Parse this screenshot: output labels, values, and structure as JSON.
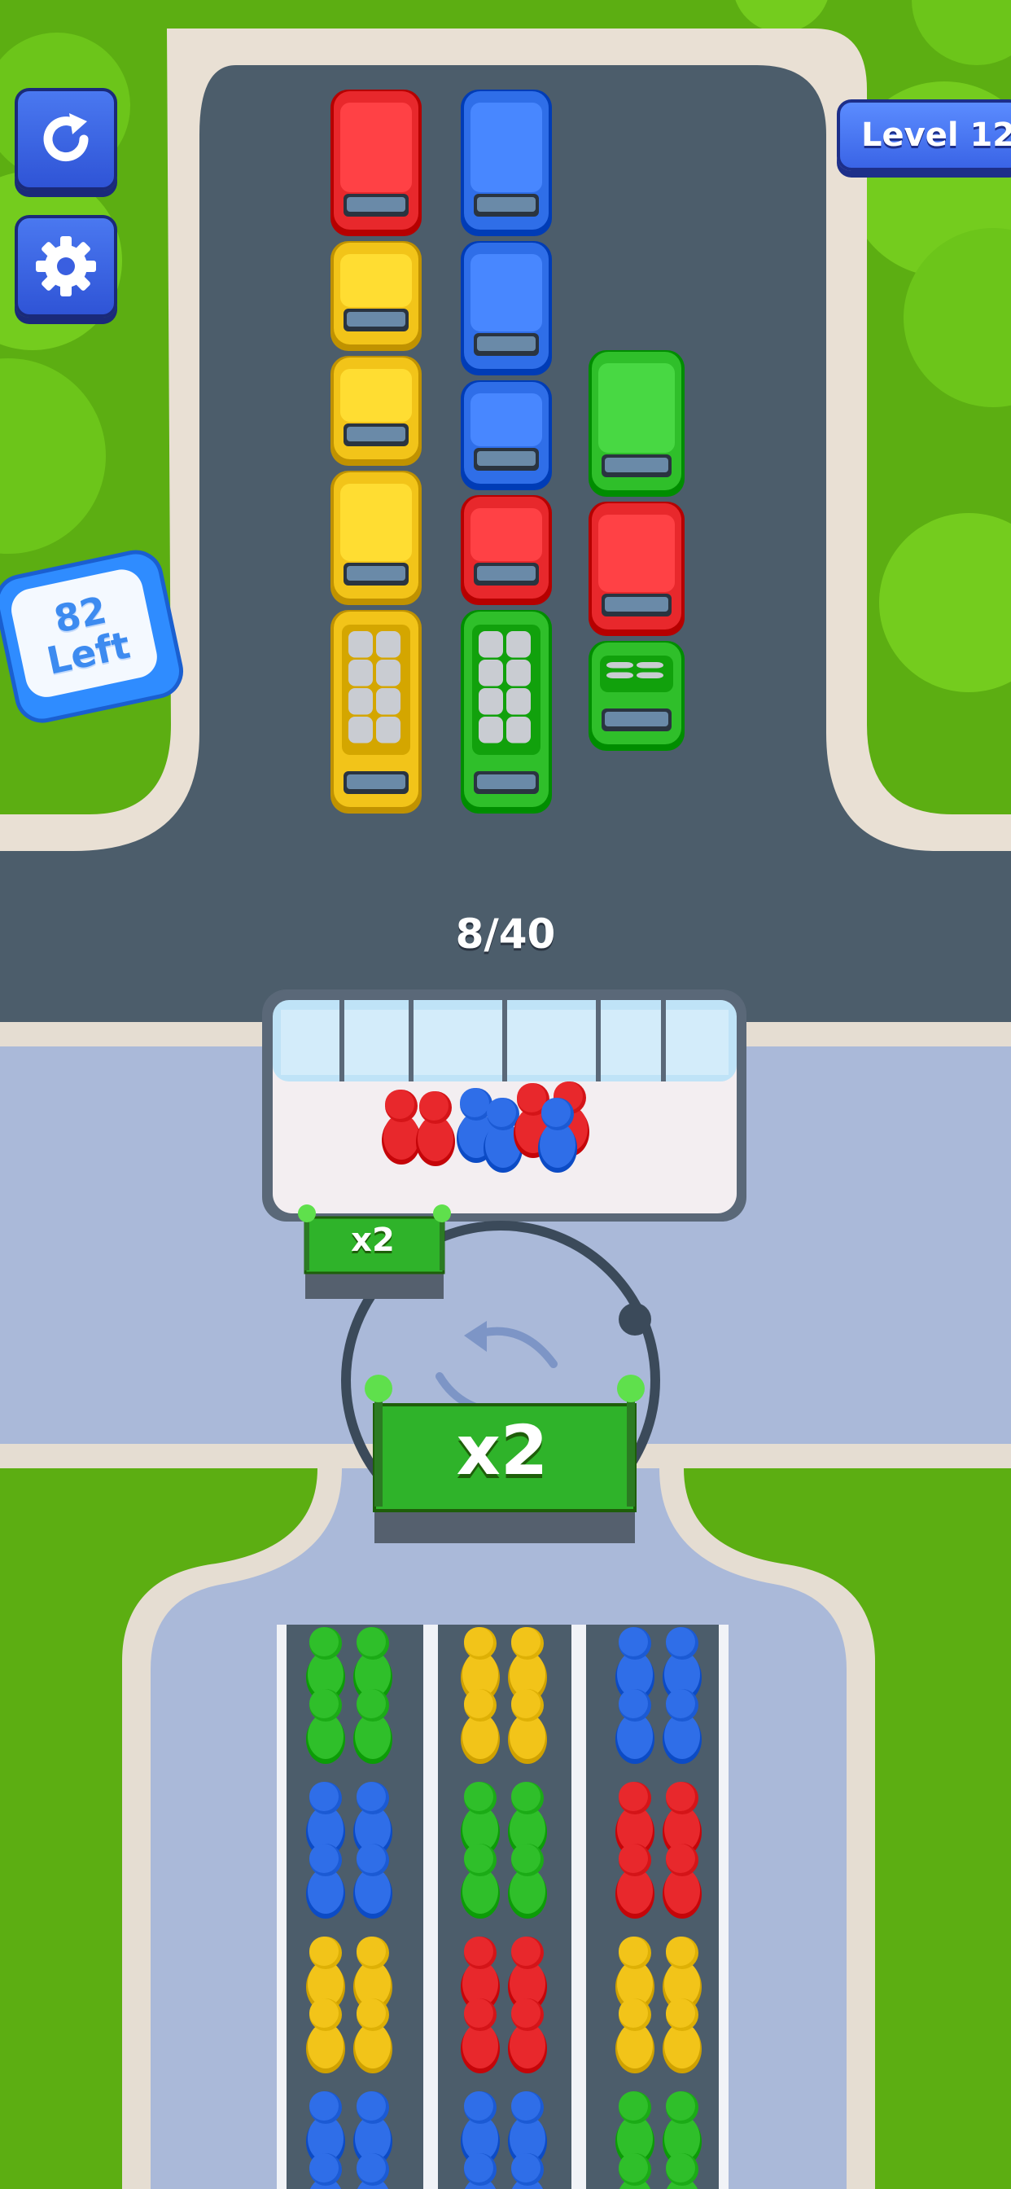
{
  "level": {
    "label": "Level 12"
  },
  "people_left": {
    "number": "82",
    "word": "Left"
  },
  "bus_stop": {
    "counter": "8/40"
  },
  "multipliers": {
    "small": "x2",
    "large": "x2"
  },
  "icons": {
    "restart": "restart-icon",
    "settings": "gear-icon"
  },
  "colors": {
    "red": "#e8282c",
    "blue": "#2f6ee8",
    "yellow": "#f2c419",
    "green": "#2fbf2a"
  },
  "parking_lot": {
    "columns": [
      [
        "red bus",
        "yellow car",
        "yellow car",
        "yellow van",
        "yellow pickup loaded"
      ],
      [
        "blue bus",
        "blue van",
        "blue car",
        "red car",
        "green pickup loaded"
      ],
      [
        "green bus",
        "red van",
        "green car loaded"
      ]
    ]
  },
  "waiting_area": {
    "people": [
      "red",
      "red",
      "blue",
      "blue",
      "red",
      "red",
      "blue"
    ]
  },
  "queue": {
    "lanes": [
      [
        "green",
        "blue",
        "yellow",
        "blue"
      ],
      [
        "yellow",
        "green",
        "red",
        "blue"
      ],
      [
        "blue",
        "red",
        "yellow",
        "green"
      ]
    ]
  }
}
